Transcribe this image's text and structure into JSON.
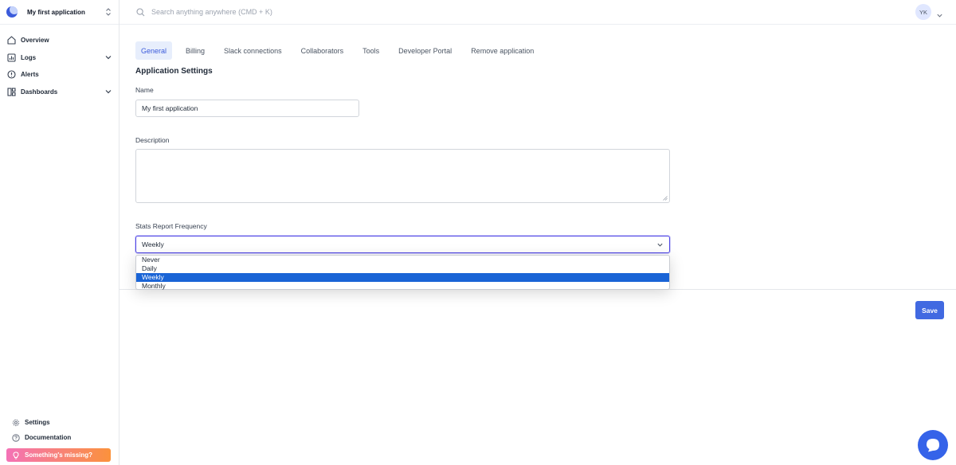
{
  "app": {
    "name": "My first application"
  },
  "sidebar": {
    "items": [
      {
        "label": "Overview",
        "icon": "home-icon"
      },
      {
        "label": "Logs",
        "icon": "chart-icon"
      },
      {
        "label": "Alerts",
        "icon": "alert-icon"
      },
      {
        "label": "Dashboards",
        "icon": "dashboard-icon"
      }
    ],
    "bottom": {
      "settings": "Settings",
      "documentation": "Documentation",
      "missing": "Something's missing?"
    }
  },
  "search": {
    "placeholder": "Search anything anywhere (CMD + K)"
  },
  "user": {
    "initials": "YK"
  },
  "tabs": [
    "General",
    "Billing",
    "Slack connections",
    "Collaborators",
    "Tools",
    "Developer Portal",
    "Remove application"
  ],
  "form": {
    "title": "Application Settings",
    "name_label": "Name",
    "name_value": "My first application",
    "description_label": "Description",
    "description_value": "",
    "frequency_label": "Stats Report Frequency",
    "frequency_value": "Weekly",
    "frequency_options": [
      "Never",
      "Daily",
      "Weekly",
      "Monthly"
    ],
    "save_label": "Save"
  },
  "colors": {
    "accent": "#4169e1",
    "selected_option": "#1a64d6",
    "active_tab_bg": "#e7eefc"
  }
}
